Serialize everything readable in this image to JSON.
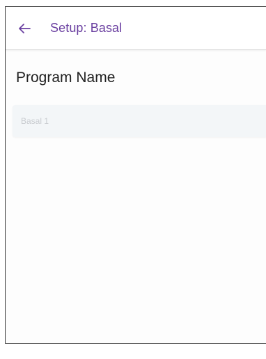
{
  "header": {
    "back_icon": "arrow-left-icon",
    "title": "Setup: Basal",
    "accent_color": "#6a3fa0"
  },
  "form": {
    "section_title": "Program Name",
    "program_name_placeholder": "Basal 1"
  }
}
